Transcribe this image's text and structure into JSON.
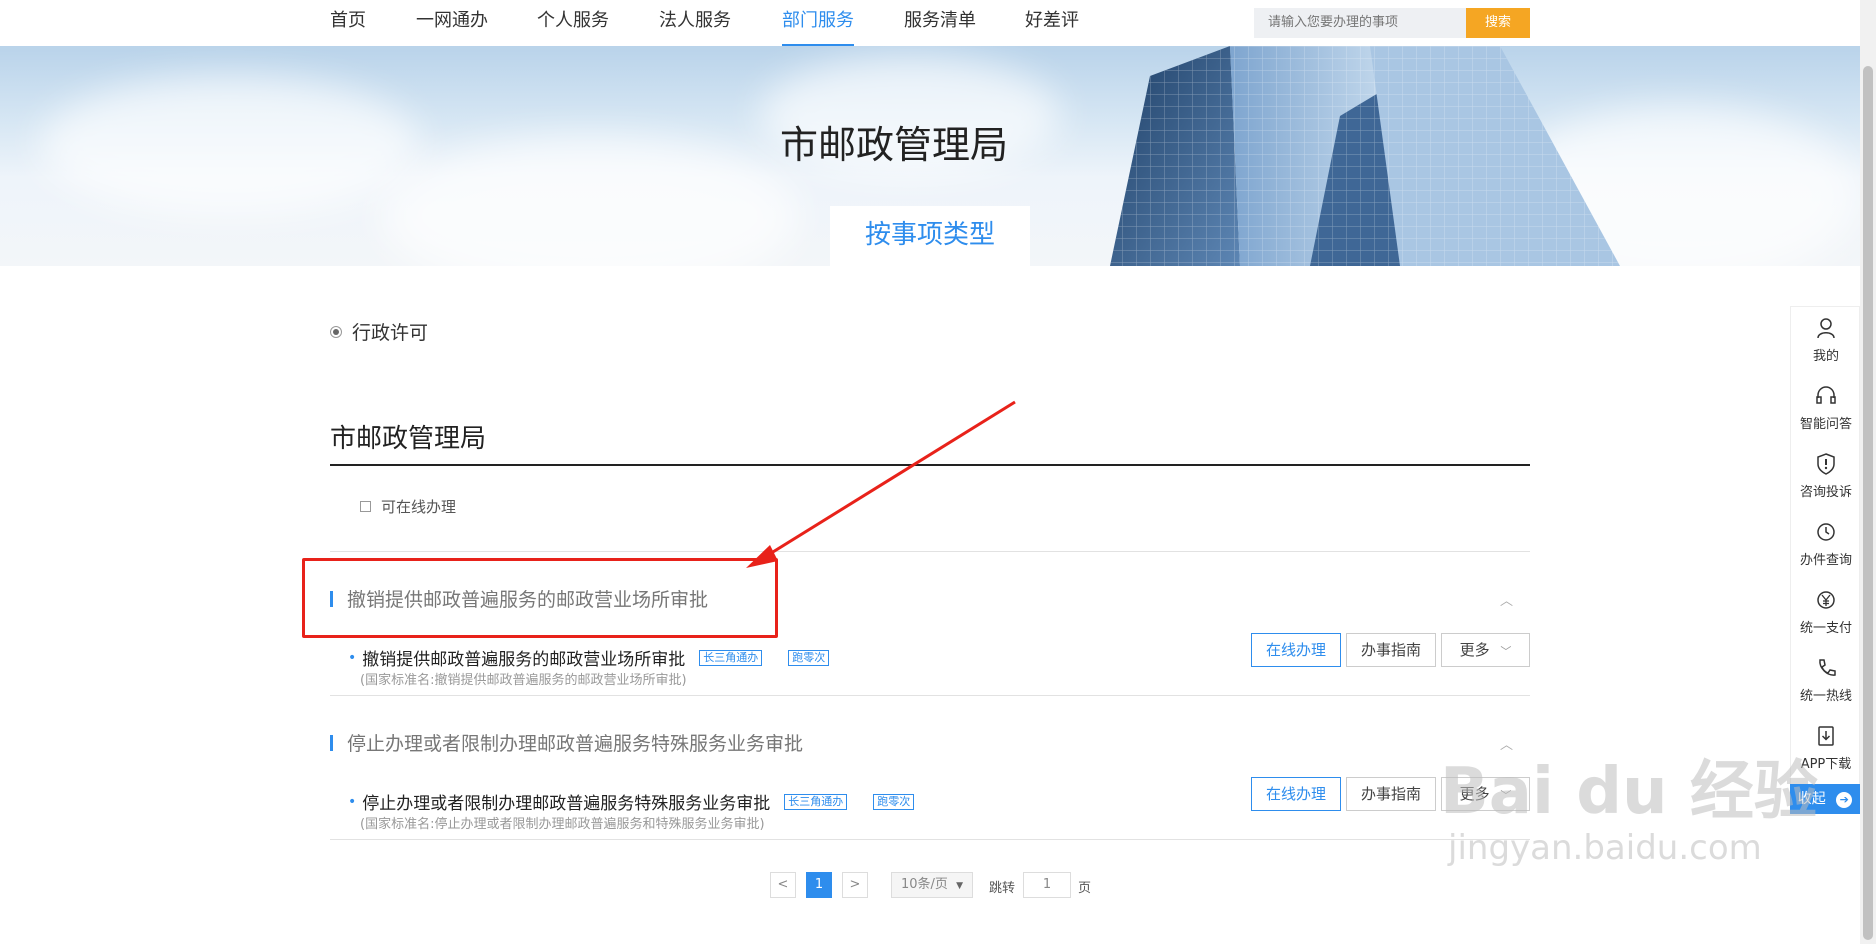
{
  "nav": {
    "items": [
      "首页",
      "一网通办",
      "个人服务",
      "法人服务",
      "部门服务",
      "服务清单",
      "好差评"
    ],
    "active": "部门服务",
    "search_placeholder": "请输入您要办理的事项",
    "search_button": "搜索"
  },
  "banner": {
    "title": "市邮政管理局",
    "tab": "按事项类型"
  },
  "category": {
    "label": "行政许可"
  },
  "department": {
    "title": "市邮政管理局",
    "online_filter": "可在线办理"
  },
  "groups": [
    {
      "title": "撤销提供邮政普遍服务的邮政营业场所审批",
      "item": {
        "title": "撤销提供邮政普遍服务的邮政营业场所审批",
        "tag1": "长三角通办",
        "tag2": "跑零次",
        "std_name": "(国家标准名:撤销提供邮政普遍服务的邮政营业场所审批)",
        "btn_online": "在线办理",
        "btn_guide": "办事指南",
        "btn_more": "更多"
      }
    },
    {
      "title": "停止办理或者限制办理邮政普遍服务特殊服务业务审批",
      "item": {
        "title": "停止办理或者限制办理邮政普遍服务特殊服务业务审批",
        "tag1": "长三角通办",
        "tag2": "跑零次",
        "std_name": "(国家标准名:停止办理或者限制办理邮政普遍服务和特殊服务业务审批)",
        "btn_online": "在线办理",
        "btn_guide": "办事指南",
        "btn_more": "更多"
      }
    }
  ],
  "pagination": {
    "prev": "<",
    "current": "1",
    "next": ">",
    "page_size": "10条/页",
    "jump_label": "跳转",
    "jump_value": "1",
    "page_unit": "页"
  },
  "sidebar": {
    "items": [
      {
        "label": "我的",
        "icon": "user-icon"
      },
      {
        "label": "智能问答",
        "icon": "headset-icon"
      },
      {
        "label": "咨询投诉",
        "icon": "alert-shield-icon"
      },
      {
        "label": "办件查询",
        "icon": "history-icon"
      },
      {
        "label": "统一支付",
        "icon": "yuan-icon"
      },
      {
        "label": "统一热线",
        "icon": "phone-icon"
      },
      {
        "label": "APP下载",
        "icon": "download-icon"
      }
    ],
    "collapse": "收起"
  },
  "watermark": {
    "text": "Bai du 经验",
    "url": "jingyan.baidu.com"
  },
  "colors": {
    "accent": "#2e8ded",
    "search_button": "#f5a623",
    "annotation": "#e8221a"
  }
}
